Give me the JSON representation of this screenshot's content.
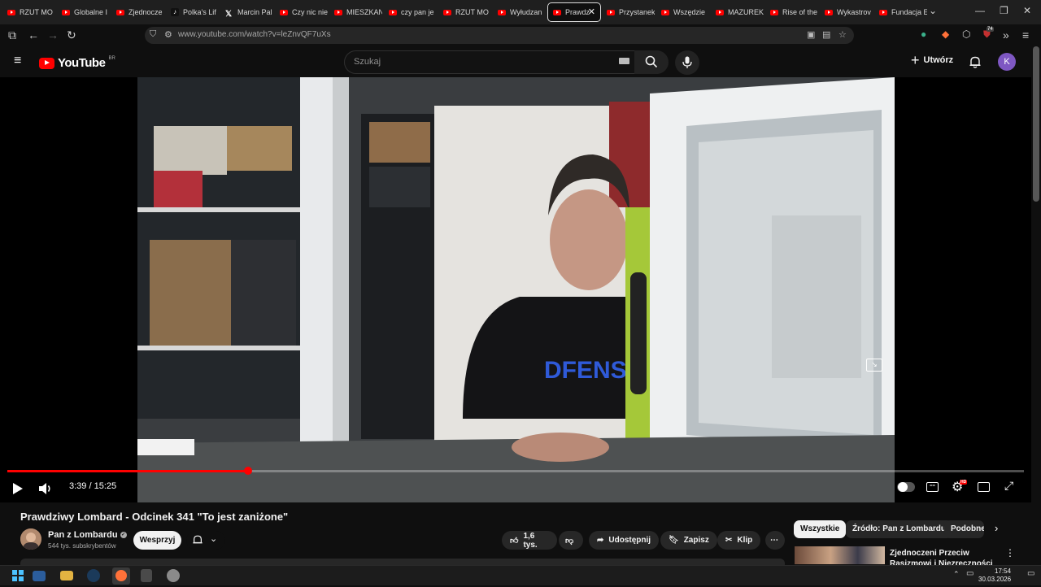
{
  "browser": {
    "tabs": [
      {
        "title": "RZUT MO",
        "icon": "youtube-icon"
      },
      {
        "title": "Globalne I",
        "icon": "youtube-icon"
      },
      {
        "title": "Zjednocze",
        "icon": "youtube-icon"
      },
      {
        "title": "Polka's Lif",
        "icon": "tiktok-icon"
      },
      {
        "title": "Marcin Pal",
        "icon": "x-icon"
      },
      {
        "title": "Czy nic nie",
        "icon": "youtube-icon"
      },
      {
        "title": "MIESZKAN",
        "icon": "youtube-icon"
      },
      {
        "title": "czy pan je",
        "icon": "youtube-icon"
      },
      {
        "title": "RZUT MO",
        "icon": "youtube-icon"
      },
      {
        "title": "Wyłudzan",
        "icon": "youtube-icon"
      },
      {
        "title": "Prawdz",
        "icon": "youtube-icon",
        "active": true
      },
      {
        "title": "Przystanek",
        "icon": "youtube-icon"
      },
      {
        "title": "Wszędzie",
        "icon": "youtube-icon"
      },
      {
        "title": "MAZUREK",
        "icon": "youtube-icon"
      },
      {
        "title": "Rise of the",
        "icon": "youtube-icon"
      },
      {
        "title": "Wykastrov",
        "icon": "youtube-icon"
      },
      {
        "title": "Fundacja E",
        "icon": "youtube-icon"
      }
    ],
    "url": "www.youtube.com/watch?v=leZnvQF7uXs",
    "extension_badge": "74"
  },
  "youtube": {
    "logo_text": "YouTube",
    "region": "BR",
    "search_placeholder": "Szukaj",
    "create_label": "Utwórz",
    "avatar_letter": "K"
  },
  "player": {
    "current_time": "3:39",
    "duration": "15:25",
    "time_display": "3:39 / 15:25",
    "progress_fraction": 0.237,
    "hd_badge": "HD"
  },
  "video": {
    "title": "Prawdziwy Lombard - Odcinek 341 \"To jest zaniżone\"",
    "channel": "Pan z Lombardu",
    "subscribers": "544 tys. subskrybentów",
    "support_label": "Wesprzyj",
    "likes": "1,6 tys.",
    "share_label": "Udostępnij",
    "save_label": "Zapisz",
    "clip_label": "Klip"
  },
  "recommendations": {
    "chips": [
      "Wszystkie",
      "Źródło: Pan z Lombardu",
      "Podobne"
    ],
    "first_title": "Zjednoczeni Przeciw Rasizmowi i Niezręczności"
  },
  "taskbar": {
    "time": "17:54",
    "date": "30.03.2026"
  },
  "colors": {
    "accent": "#ff0000",
    "background": "#0f0f0f",
    "pill": "#272727"
  }
}
